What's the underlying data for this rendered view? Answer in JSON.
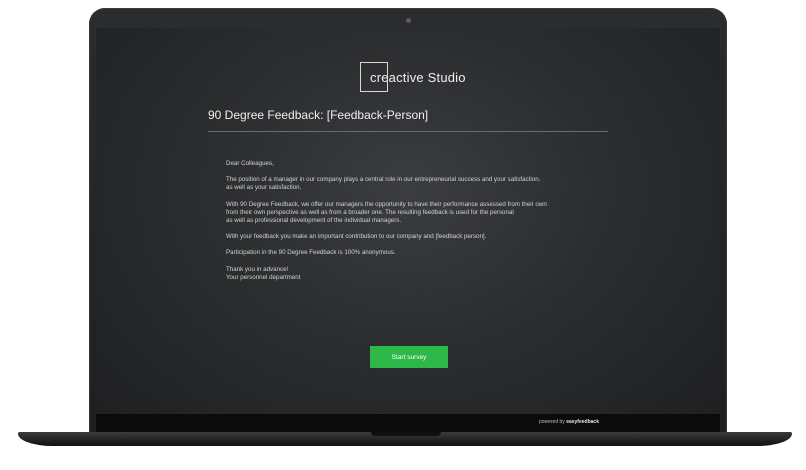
{
  "logo": {
    "text": "creactive Studio"
  },
  "survey": {
    "title": "90 Degree Feedback: [Feedback-Person]",
    "letter": {
      "greeting": "Dear Colleagues,",
      "para1": [
        "The position of a manager in our company plays a central role in our entrepreneurial success and your satisfaction.",
        "as well as your satisfaction."
      ],
      "para2": [
        "With 90 Degree Feedback, we offer our managers the opportunity to have their performance assessed from their own",
        "from their own perspective as well as from a broader one. The resulting feedback is used for the personal",
        "as well as professional development of the individual managers."
      ],
      "para3": "With your feedback you make an important contribution to our company and [feedback person].",
      "para4": "Participation in the 90 Degree Feedback is 100% anonymous.",
      "closing": [
        "Thank you in advance!",
        "Your personnel department"
      ]
    },
    "start_button_label": "Start survey"
  },
  "footer": {
    "powered_prefix": "powered by",
    "powered_brand": "easyfeedback"
  }
}
